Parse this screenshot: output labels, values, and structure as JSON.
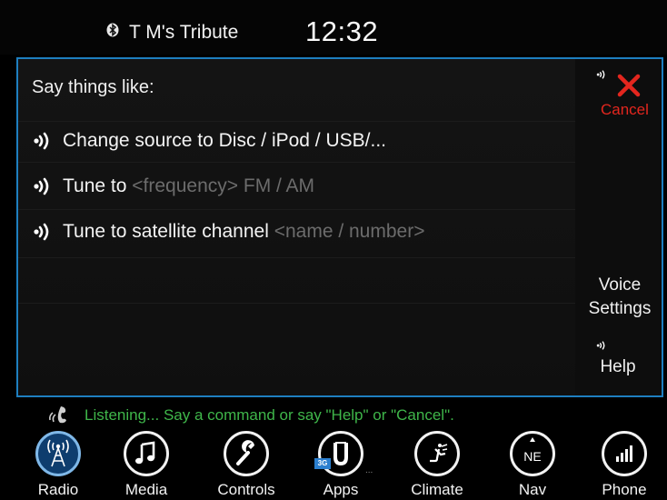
{
  "status": {
    "device_name": "T M's Tribute",
    "time": "12:32",
    "bluetooth_icon": "bluetooth-icon"
  },
  "voice_panel": {
    "title": "Say things like:",
    "commands": [
      {
        "text": "Change source to Disc / iPod / USB/...",
        "hint": ""
      },
      {
        "text": "Tune to ",
        "hint": "<frequency> FM / AM"
      },
      {
        "text": "Tune to satellite channel ",
        "hint": "<name / number>"
      }
    ],
    "cancel_label": "Cancel",
    "voice_settings_line1": "Voice",
    "voice_settings_line2": "Settings",
    "help_label": "Help"
  },
  "listening": {
    "text": "Listening... Say a command or say \"Help\" or \"Cancel\"."
  },
  "nav": {
    "items": [
      {
        "label": "Radio",
        "icon": "radio-tower-icon",
        "active": true
      },
      {
        "label": "Media",
        "icon": "music-note-icon"
      },
      {
        "label": "Controls",
        "icon": "wrench-icon"
      },
      {
        "label": "Apps",
        "icon": "uconnect-icon",
        "badge": "3G"
      },
      {
        "label": "Climate",
        "icon": "climate-seat-icon"
      },
      {
        "label": "Nav",
        "icon": "compass-ne-icon",
        "icon_text": "NE"
      },
      {
        "label": "Phone",
        "icon": "signal-bars-icon"
      }
    ]
  },
  "colors": {
    "accent_border": "#1e7fc0",
    "cancel_red": "#e3261e",
    "listening_green": "#3fb64a",
    "hint_gray": "#6c6c6c"
  }
}
